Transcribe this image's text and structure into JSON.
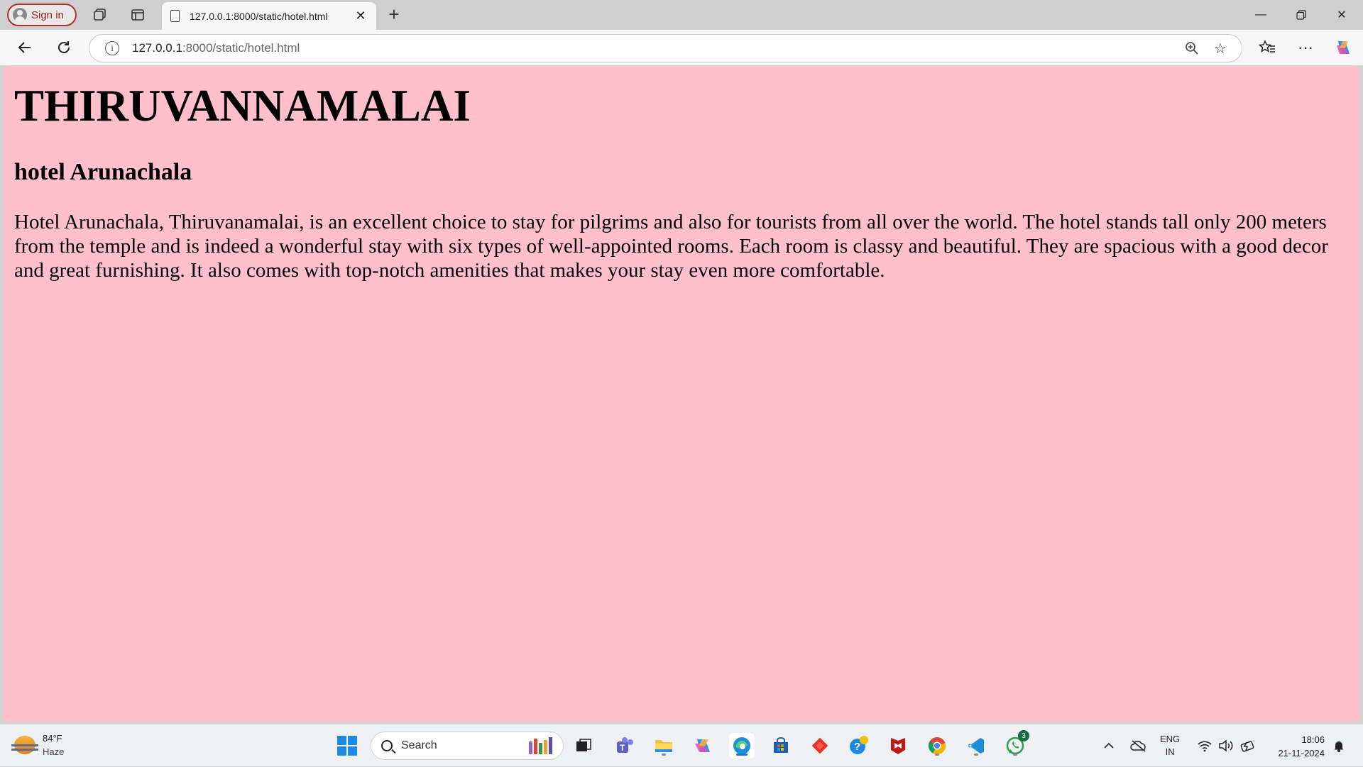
{
  "browser": {
    "signin_label": "Sign in",
    "tab_title": "127.0.0.1:8000/static/hotel.html",
    "url_host": "127.0.0.1",
    "url_path": ":8000/static/hotel.html"
  },
  "page": {
    "heading": "THIRUVANNAMALAI",
    "subheading": "hotel Arunachala",
    "paragraph": "Hotel Arunachala, Thiruvanamalai, is an excellent choice to stay for pilgrims and also for tourists from all over the world. The hotel stands tall only 200 meters from the temple and is indeed a wonderful stay with six types of well-appointed rooms. Each room is classy and beautiful. They are spacious with a good decor and great furnishing. It also comes with top-notch amenities that makes your stay even more comfortable.",
    "background_color": "#ffc0cb"
  },
  "taskbar": {
    "weather_temp": "84°F",
    "weather_condition": "Haze",
    "search_placeholder": "Search",
    "whatsapp_badge": "3",
    "lang_line1": "ENG",
    "lang_line2": "IN",
    "time": "18:06",
    "date": "21-11-2024"
  }
}
